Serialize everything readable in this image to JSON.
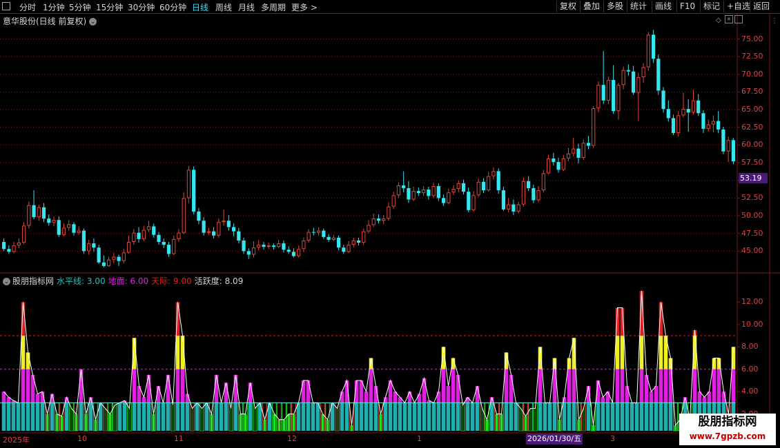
{
  "toolbar": {
    "timeframes": [
      "分时",
      "1分钟",
      "5分钟",
      "15分钟",
      "30分钟",
      "60分钟",
      "日线",
      "周线",
      "月线",
      "多周期",
      "更多 >"
    ],
    "active": "日线",
    "right_buttons": [
      "复权",
      "叠加",
      "多股",
      "统计",
      "画线",
      "F10",
      "标记",
      "+自选",
      "返回"
    ]
  },
  "main": {
    "title": "意华股份(日线 前复权)",
    "price_ticks": [
      "75.00",
      "72.50",
      "70.00",
      "67.50",
      "65.00",
      "62.50",
      "60.00",
      "57.50",
      "55.00",
      "52.50",
      "50.00",
      "47.50",
      "45.00"
    ],
    "last_price": "53.19"
  },
  "indicator": {
    "name": "股朋指标网",
    "shuiping": "水平线: 3.00",
    "dimian": "地面: 6.00",
    "tianji": "天际: 9.00",
    "huoyue": "活跃度: 8.09",
    "ticks": [
      "12.00",
      "10.00",
      "8.00",
      "6.00",
      "4.00",
      "2.00"
    ]
  },
  "dates": {
    "labels": [
      "2025年",
      "10",
      "11",
      "12",
      "1",
      "3"
    ],
    "selected": "2026/01/30/五"
  },
  "watermark": {
    "title": "股朋指标网",
    "url": "www.7gpzb.com"
  },
  "colors": {
    "up": "#e0483a",
    "down": "#35e5f0",
    "grid": "#7a1a1a",
    "magenta": "#e020e0",
    "yellow": "#f0f020",
    "red": "#e02020",
    "teal": "#20b0b0",
    "green": "#20e020"
  },
  "chart_data": [
    {
      "type": "candlestick",
      "title": "意华股份(日线 前复权)",
      "ylim": [
        42.5,
        77.0
      ],
      "candles": [
        [
          46.3,
          45.3,
          46.8,
          45.0
        ],
        [
          45.3,
          44.9,
          45.8,
          44.6
        ],
        [
          44.9,
          45.8,
          46.3,
          44.7
        ],
        [
          45.8,
          46.2,
          46.8,
          45.4
        ],
        [
          46.2,
          48.6,
          49.1,
          46.0
        ],
        [
          48.6,
          51.5,
          52.0,
          48.2
        ],
        [
          51.5,
          49.8,
          53.6,
          49.5
        ],
        [
          49.8,
          51.2,
          51.6,
          49.3
        ],
        [
          51.2,
          49.6,
          51.8,
          49.1
        ],
        [
          49.6,
          49.0,
          50.2,
          48.6
        ],
        [
          49.0,
          49.4,
          49.9,
          48.5
        ],
        [
          49.4,
          47.3,
          49.9,
          47.0
        ],
        [
          47.3,
          48.3,
          48.9,
          47.1
        ],
        [
          48.3,
          48.8,
          49.4,
          47.9
        ],
        [
          48.8,
          47.6,
          49.1,
          47.2
        ],
        [
          47.6,
          47.9,
          48.5,
          47.3
        ],
        [
          47.9,
          45.0,
          48.2,
          44.6
        ],
        [
          45.0,
          46.1,
          46.6,
          44.5
        ],
        [
          46.1,
          45.5,
          46.8,
          44.9
        ],
        [
          45.5,
          43.4,
          45.9,
          43.2
        ],
        [
          43.4,
          42.9,
          44.4,
          42.7
        ],
        [
          42.9,
          43.8,
          44.2,
          42.8
        ],
        [
          43.8,
          44.2,
          44.8,
          43.3
        ],
        [
          44.2,
          43.6,
          44.5,
          42.9
        ],
        [
          43.6,
          44.8,
          45.3,
          43.3
        ],
        [
          44.8,
          46.3,
          47.2,
          44.6
        ],
        [
          46.3,
          47.6,
          48.1,
          45.9
        ],
        [
          47.6,
          46.7,
          48.4,
          46.2
        ],
        [
          46.7,
          48.0,
          48.6,
          46.4
        ],
        [
          48.0,
          48.5,
          49.3,
          47.7
        ],
        [
          48.5,
          47.3,
          48.9,
          46.9
        ],
        [
          47.3,
          46.3,
          47.7,
          45.9
        ],
        [
          46.3,
          45.9,
          46.8,
          45.4
        ],
        [
          45.9,
          44.6,
          46.3,
          44.2
        ],
        [
          44.6,
          46.7,
          47.2,
          44.4
        ],
        [
          46.7,
          47.6,
          48.1,
          46.3
        ],
        [
          47.6,
          52.5,
          53.3,
          47.4
        ],
        [
          52.5,
          56.5,
          57.0,
          51.8
        ],
        [
          56.5,
          50.6,
          57.0,
          50.2
        ],
        [
          50.6,
          49.3,
          51.1,
          48.8
        ],
        [
          49.3,
          47.6,
          49.8,
          47.2
        ],
        [
          47.6,
          47.8,
          48.3,
          47.3
        ],
        [
          47.8,
          47.2,
          48.4,
          46.8
        ],
        [
          47.2,
          49.1,
          49.6,
          46.9
        ],
        [
          49.1,
          49.3,
          50.9,
          48.6
        ],
        [
          49.3,
          48.4,
          50.1,
          47.9
        ],
        [
          48.4,
          47.8,
          48.9,
          47.1
        ],
        [
          47.8,
          46.5,
          48.3,
          46.1
        ],
        [
          46.5,
          45.0,
          46.9,
          44.6
        ],
        [
          45.0,
          44.5,
          45.4,
          43.9
        ],
        [
          44.5,
          45.5,
          46.4,
          44.1
        ],
        [
          45.5,
          45.9,
          46.6,
          45.1
        ],
        [
          45.9,
          45.6,
          46.3,
          45.2
        ],
        [
          45.6,
          45.8,
          46.2,
          45.3
        ],
        [
          45.8,
          45.6,
          46.1,
          45.2
        ],
        [
          45.6,
          46.1,
          46.6,
          45.4
        ],
        [
          46.1,
          45.2,
          46.5,
          44.8
        ],
        [
          45.2,
          44.9,
          45.7,
          44.6
        ],
        [
          44.9,
          44.3,
          45.4,
          44.1
        ],
        [
          44.3,
          45.3,
          45.8,
          44.1
        ],
        [
          45.3,
          46.5,
          46.9,
          44.9
        ],
        [
          46.5,
          47.7,
          48.1,
          46.2
        ],
        [
          47.7,
          47.6,
          48.3,
          47.2
        ],
        [
          47.6,
          47.9,
          48.4,
          47.2
        ],
        [
          47.9,
          47.0,
          48.2,
          46.7
        ],
        [
          47.0,
          46.6,
          47.4,
          46.3
        ],
        [
          46.6,
          46.9,
          47.3,
          46.4
        ],
        [
          46.9,
          45.5,
          47.2,
          45.1
        ],
        [
          45.5,
          44.9,
          45.9,
          44.6
        ],
        [
          44.9,
          45.9,
          46.4,
          44.7
        ],
        [
          45.9,
          46.5,
          46.9,
          45.5
        ],
        [
          46.5,
          46.2,
          46.9,
          45.8
        ],
        [
          46.2,
          47.8,
          48.2,
          45.9
        ],
        [
          47.8,
          48.7,
          49.4,
          47.5
        ],
        [
          48.7,
          49.6,
          50.3,
          48.4
        ],
        [
          49.6,
          49.3,
          50.2,
          48.9
        ],
        [
          49.3,
          49.6,
          50.1,
          48.8
        ],
        [
          49.6,
          51.3,
          51.9,
          49.3
        ],
        [
          51.3,
          52.9,
          53.4,
          51.0
        ],
        [
          52.9,
          54.3,
          54.7,
          52.5
        ],
        [
          54.3,
          53.9,
          56.3,
          53.3
        ],
        [
          53.9,
          52.3,
          54.9,
          51.8
        ],
        [
          52.3,
          53.5,
          54.1,
          52.1
        ],
        [
          53.5,
          53.2,
          54.0,
          52.8
        ],
        [
          53.2,
          53.7,
          54.2,
          52.8
        ],
        [
          53.7,
          52.8,
          54.1,
          52.3
        ],
        [
          52.8,
          54.2,
          54.7,
          52.5
        ],
        [
          54.2,
          52.5,
          54.6,
          52.1
        ],
        [
          52.5,
          51.8,
          53.0,
          51.4
        ],
        [
          51.8,
          53.3,
          53.8,
          51.6
        ],
        [
          53.3,
          53.8,
          54.3,
          52.9
        ],
        [
          53.8,
          54.6,
          55.0,
          53.3
        ],
        [
          54.6,
          53.4,
          55.1,
          53.0
        ],
        [
          53.4,
          50.8,
          54.0,
          50.5
        ],
        [
          50.8,
          52.9,
          53.5,
          50.6
        ],
        [
          52.9,
          54.8,
          55.3,
          52.6
        ],
        [
          54.8,
          53.6,
          55.3,
          53.2
        ],
        [
          53.6,
          55.6,
          56.2,
          53.4
        ],
        [
          55.6,
          56.3,
          56.8,
          55.1
        ],
        [
          56.3,
          53.6,
          56.7,
          53.1
        ],
        [
          53.6,
          50.9,
          54.1,
          50.7
        ],
        [
          50.9,
          51.6,
          52.5,
          50.5
        ],
        [
          51.6,
          50.6,
          52.3,
          50.1
        ],
        [
          50.6,
          51.6,
          52.0,
          50.3
        ],
        [
          51.6,
          54.9,
          55.4,
          51.3
        ],
        [
          54.9,
          53.9,
          55.6,
          53.5
        ],
        [
          53.9,
          52.2,
          54.4,
          51.8
        ],
        [
          52.2,
          53.6,
          54.2,
          51.9
        ],
        [
          53.6,
          56.0,
          56.5,
          53.3
        ],
        [
          56.0,
          58.1,
          58.6,
          55.8
        ],
        [
          58.1,
          57.6,
          58.9,
          57.1
        ],
        [
          57.6,
          56.5,
          58.2,
          56.1
        ],
        [
          56.5,
          58.1,
          58.6,
          56.3
        ],
        [
          58.1,
          58.8,
          59.6,
          57.7
        ],
        [
          58.8,
          59.5,
          61.0,
          58.4
        ],
        [
          59.5,
          58.2,
          60.2,
          57.4
        ],
        [
          58.2,
          60.3,
          60.8,
          57.9
        ],
        [
          60.3,
          59.9,
          61.3,
          59.4
        ],
        [
          59.9,
          65.2,
          65.5,
          59.6
        ],
        [
          65.2,
          68.5,
          69.0,
          64.6
        ],
        [
          68.5,
          66.3,
          73.3,
          65.8
        ],
        [
          66.3,
          69.2,
          69.7,
          65.8
        ],
        [
          69.2,
          64.8,
          71.3,
          64.4
        ],
        [
          64.8,
          68.5,
          68.8,
          63.6
        ],
        [
          68.5,
          70.6,
          71.1,
          67.9
        ],
        [
          70.6,
          70.4,
          71.4,
          69.8
        ],
        [
          70.4,
          67.4,
          71.2,
          67.1
        ],
        [
          67.4,
          69.6,
          70.2,
          63.4
        ],
        [
          69.6,
          71.0,
          71.6,
          68.8
        ],
        [
          71.0,
          75.6,
          76.0,
          70.5
        ],
        [
          75.6,
          72.2,
          76.3,
          71.6
        ],
        [
          72.2,
          67.7,
          72.8,
          67.1
        ],
        [
          67.7,
          65.1,
          68.2,
          64.6
        ],
        [
          65.1,
          63.8,
          66.3,
          63.3
        ],
        [
          63.8,
          61.7,
          64.3,
          61.4
        ],
        [
          61.7,
          64.2,
          64.8,
          61.2
        ],
        [
          64.2,
          65.1,
          67.4,
          63.9
        ],
        [
          65.1,
          64.6,
          66.5,
          61.9
        ],
        [
          64.6,
          66.3,
          67.8,
          64.3
        ],
        [
          66.3,
          64.5,
          67.2,
          64.1
        ],
        [
          64.5,
          62.3,
          64.9,
          61.7
        ],
        [
          62.3,
          62.9,
          63.6,
          61.9
        ],
        [
          62.9,
          63.4,
          64.2,
          61.8
        ],
        [
          63.4,
          62.2,
          64.8,
          61.7
        ],
        [
          62.2,
          59.1,
          62.6,
          58.7
        ],
        [
          59.1,
          60.7,
          61.2,
          57.6
        ],
        [
          60.7,
          57.7,
          61.0,
          57.3
        ]
      ]
    },
    {
      "type": "bar",
      "title": "股朋指标网",
      "ylim": [
        0.5,
        13.5
      ],
      "levels": {
        "shuiping": 3.0,
        "dimian": 6.0,
        "tianji": 9.0
      },
      "values": [
        4.0,
        3.5,
        3.2,
        3.0,
        12.0,
        7.5,
        5.5,
        3.8,
        4.0,
        2.0,
        3.8,
        2.0,
        1.8,
        3.5,
        2.5,
        2.0,
        6.0,
        2.0,
        3.5,
        1.5,
        3.0,
        2.5,
        2.0,
        2.8,
        3.0,
        3.2,
        2.5,
        8.8,
        4.5,
        3.5,
        5.5,
        2.0,
        4.5,
        3.0,
        5.5,
        2.8,
        12.0,
        9.0,
        3.8,
        2.5,
        3.0,
        2.5,
        3.0,
        2.0,
        5.5,
        3.0,
        4.8,
        2.5,
        5.5,
        2.0,
        2.0,
        4.8,
        2.5,
        3.0,
        1.5,
        3.0,
        2.0,
        1.5,
        1.5,
        2.0,
        2.0,
        3.0,
        5.0,
        5.0,
        3.0,
        3.0,
        2.0,
        1.5,
        3.0,
        2.5,
        4.0,
        5.0,
        1.0,
        5.0,
        5.0,
        4.0,
        7.0,
        4.5,
        2.0,
        3.5,
        5.0,
        4.0,
        3.5,
        3.0,
        4.0,
        3.0,
        3.8,
        5.2,
        3.2,
        3.0,
        4.0,
        8.0,
        4.5,
        7.0,
        5.5,
        2.8,
        3.5,
        3.0,
        4.5,
        2.5,
        1.5,
        3.5,
        2.0,
        2.0,
        7.5,
        5.5,
        3.0,
        2.5,
        1.8,
        2.5,
        2.5,
        8.0,
        3.0,
        3.0,
        7.0,
        1.5,
        3.5,
        7.0,
        8.8,
        1.5,
        2.5,
        4.5,
        1.0,
        5.0,
        3.5,
        4.0,
        3.0,
        11.5,
        11.5,
        4.5,
        3.0,
        3.0,
        13.0,
        5.5,
        4.0,
        4.5,
        12.0,
        9.0,
        7.0,
        1.0,
        1.5,
        3.5,
        1.5,
        9.5,
        4.0,
        3.5,
        4.0,
        7.0,
        7.0,
        4.0,
        2.0,
        8.0
      ]
    }
  ]
}
